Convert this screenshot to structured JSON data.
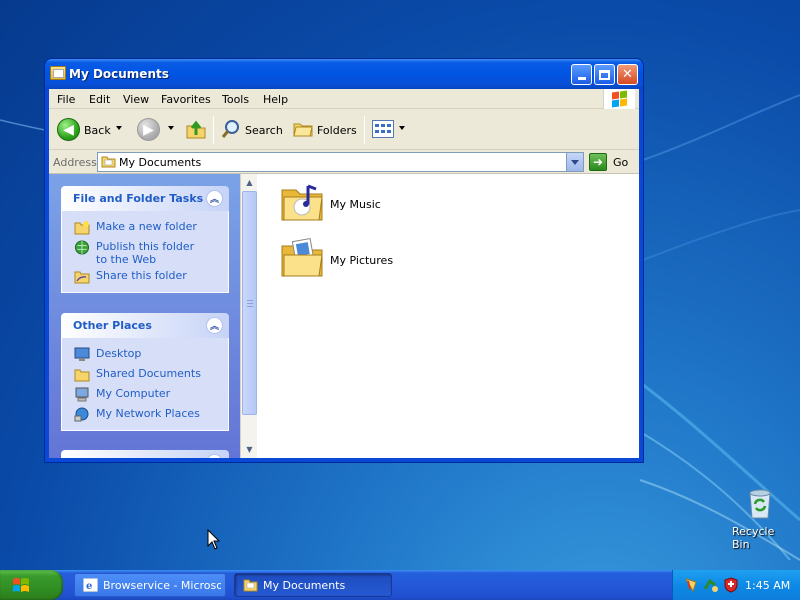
{
  "window": {
    "title": "My Documents",
    "menu": [
      "File",
      "Edit",
      "View",
      "Favorites",
      "Tools",
      "Help"
    ],
    "toolbar": {
      "back_label": "Back",
      "search_label": "Search",
      "folders_label": "Folders"
    },
    "address": {
      "label": "Address",
      "value": "My Documents",
      "go_label": "Go"
    },
    "task_pane": {
      "file_tasks": {
        "title": "File and Folder Tasks",
        "items": [
          "Make a new folder",
          "Publish this folder to the Web",
          "Share this folder"
        ]
      },
      "other_places": {
        "title": "Other Places",
        "items": [
          "Desktop",
          "Shared Documents",
          "My Computer",
          "My Network Places"
        ]
      }
    },
    "files": [
      "My Music",
      "My Pictures"
    ]
  },
  "desktop": {
    "recycle_bin_label": "Recycle Bin"
  },
  "taskbar": {
    "buttons": [
      "Browservice - Microso...",
      "My Documents"
    ],
    "clock": "1:45 AM"
  }
}
